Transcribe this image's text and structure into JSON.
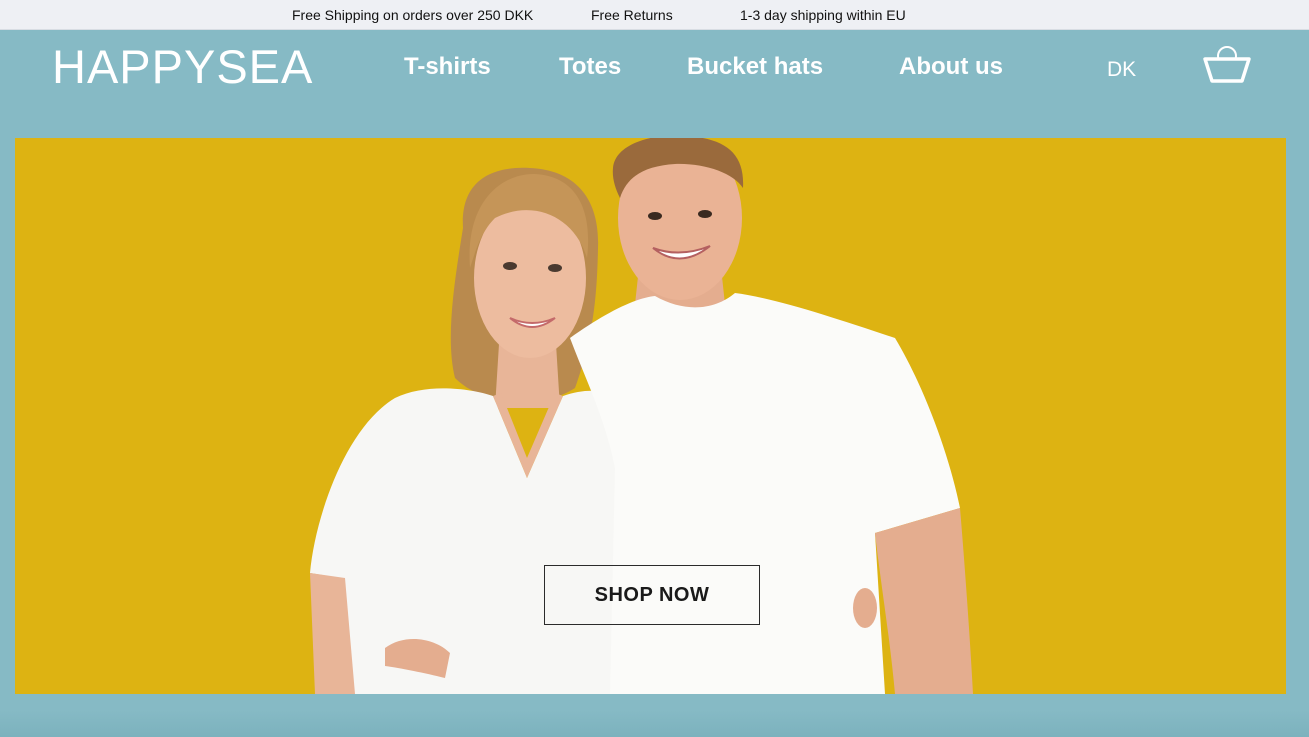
{
  "announcements": [
    "Free Shipping on orders over 250 DKK",
    "Free Returns",
    "1-3 day shipping within EU"
  ],
  "header": {
    "logo": "HAPPYSEA",
    "nav": [
      "T-shirts",
      "Totes",
      "Bucket hats",
      "About us"
    ],
    "language": "DK",
    "cart_icon": "basket-icon"
  },
  "hero": {
    "cta_label": "SHOP NOW",
    "image_subject": "hero-photo"
  },
  "colors": {
    "page_background": "#86bac5",
    "hero_background": "#ddb312",
    "topbar_background": "#eef0f4",
    "text_light": "#ffffff"
  }
}
